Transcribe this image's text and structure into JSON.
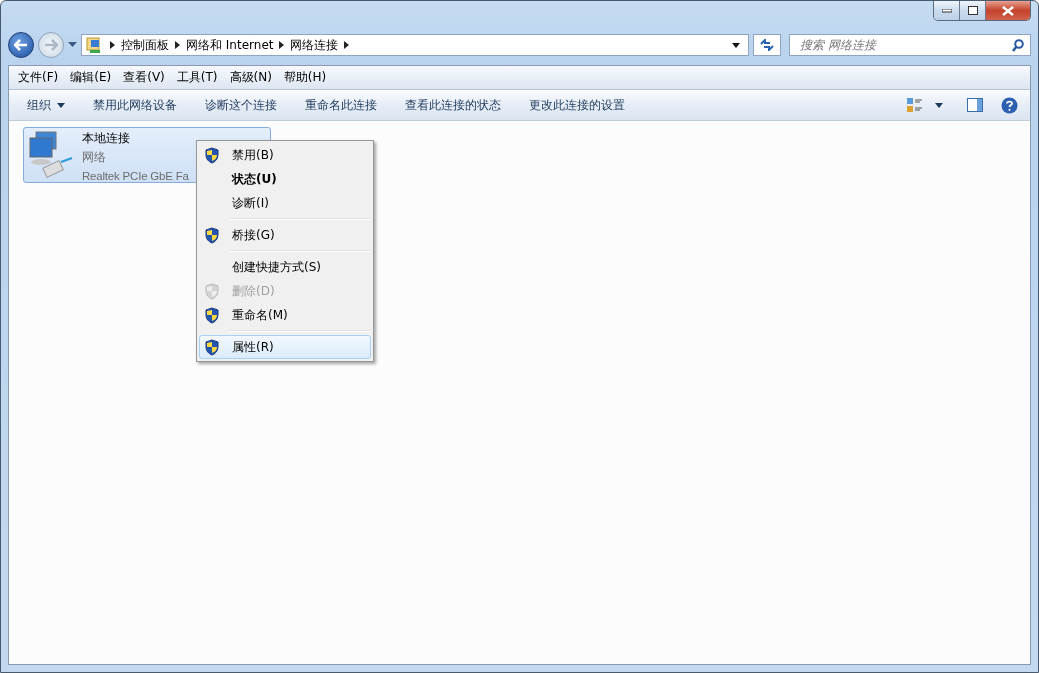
{
  "breadcrumb": [
    "控制面板",
    "网络和 Internet",
    "网络连接"
  ],
  "search": {
    "placeholder": "搜索 网络连接"
  },
  "menu_bar": [
    "文件(F)",
    "编辑(E)",
    "查看(V)",
    "工具(T)",
    "高级(N)",
    "帮助(H)"
  ],
  "toolbar": [
    {
      "label": "组织",
      "dropdown": true
    },
    {
      "label": "禁用此网络设备",
      "dropdown": false
    },
    {
      "label": "诊断这个连接",
      "dropdown": false
    },
    {
      "label": "重命名此连接",
      "dropdown": false
    },
    {
      "label": "查看此连接的状态",
      "dropdown": false
    },
    {
      "label": "更改此连接的设置",
      "dropdown": false
    }
  ],
  "connection": {
    "name": "本地连接",
    "network": "网络",
    "adapter": "Realtek PCIe GbE Fa",
    "selected": true
  },
  "context_menu": [
    {
      "kind": "item",
      "label": "禁用(B)",
      "shield": true,
      "bold": false,
      "disabled": false,
      "selected": false
    },
    {
      "kind": "item",
      "label": "状态(U)",
      "shield": false,
      "bold": true,
      "disabled": false,
      "selected": false
    },
    {
      "kind": "item",
      "label": "诊断(I)",
      "shield": false,
      "bold": false,
      "disabled": false,
      "selected": false
    },
    {
      "kind": "separator"
    },
    {
      "kind": "item",
      "label": "桥接(G)",
      "shield": true,
      "bold": false,
      "disabled": false,
      "selected": false
    },
    {
      "kind": "separator"
    },
    {
      "kind": "item",
      "label": "创建快捷方式(S)",
      "shield": false,
      "bold": false,
      "disabled": false,
      "selected": false
    },
    {
      "kind": "item",
      "label": "删除(D)",
      "shield": true,
      "bold": false,
      "disabled": true,
      "selected": false
    },
    {
      "kind": "item",
      "label": "重命名(M)",
      "shield": true,
      "bold": false,
      "disabled": false,
      "selected": false
    },
    {
      "kind": "separator"
    },
    {
      "kind": "item",
      "label": "属性(R)",
      "shield": true,
      "bold": false,
      "disabled": false,
      "selected": true
    }
  ]
}
